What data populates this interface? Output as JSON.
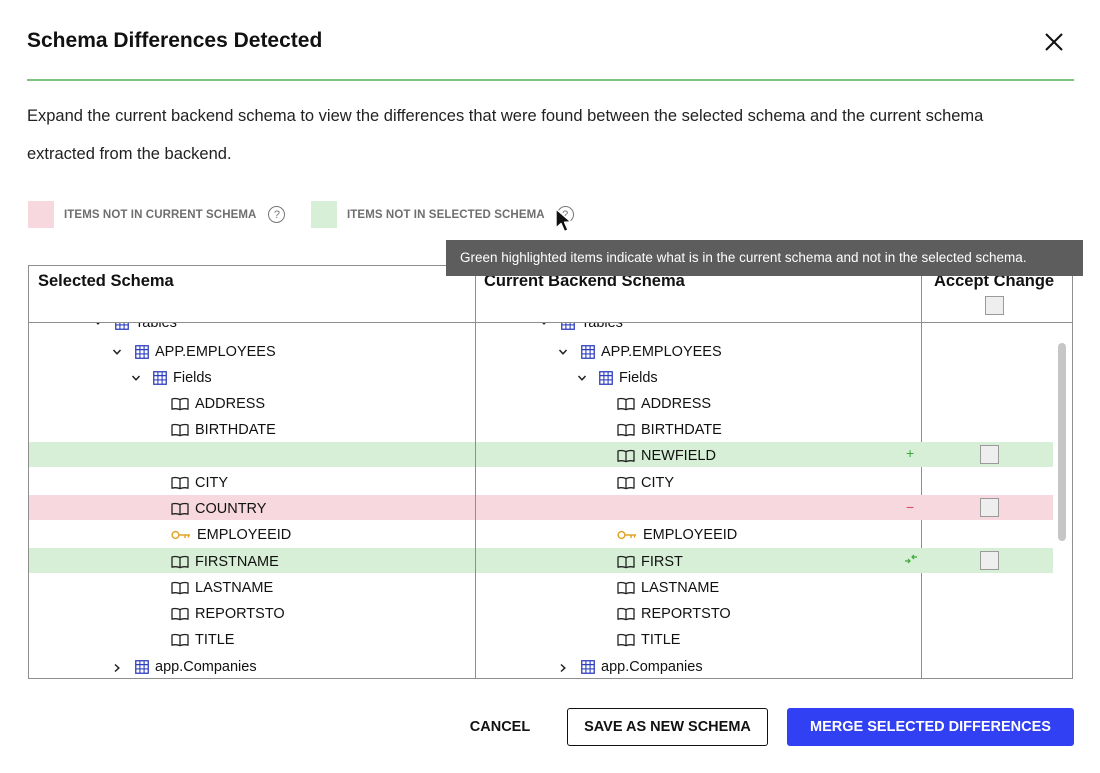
{
  "dialog": {
    "title": "Schema Differences Detected",
    "description": "Expand the current backend schema to view the differences that were found between the selected schema and the current schema extracted from the backend."
  },
  "legend": {
    "not_in_current": {
      "label": "ITEMS NOT IN CURRENT SCHEMA",
      "color": "#f6d8de",
      "help_icon": "?"
    },
    "not_in_selected": {
      "label": "ITEMS NOT IN SELECTED SCHEMA",
      "color": "#d6efd6",
      "help_icon": "?"
    }
  },
  "tooltip": "Green highlighted items indicate what is in the current schema and not in the selected schema.",
  "table": {
    "headers": {
      "selected": "Selected Schema",
      "current": "Current Backend Schema",
      "accept": "Accept Change"
    },
    "selected_tree": {
      "tables_label": "Tables",
      "employees_label": "APP.EMPLOYEES",
      "fields_label": "Fields",
      "field_address": "ADDRESS",
      "field_birthdate": "BIRTHDATE",
      "field_city": "CITY",
      "field_country": "COUNTRY",
      "field_employeeid": "EMPLOYEEID",
      "field_firstname": "FIRSTNAME",
      "field_lastname": "LASTNAME",
      "field_reportsto": "REPORTSTO",
      "field_title": "TITLE",
      "companies_label": "app.Companies"
    },
    "current_tree": {
      "tables_label": "Tables",
      "employees_label": "APP.EMPLOYEES",
      "fields_label": "Fields",
      "field_address": "ADDRESS",
      "field_birthdate": "BIRTHDATE",
      "field_newfield": "NEWFIELD",
      "field_city": "CITY",
      "field_employeeid": "EMPLOYEEID",
      "field_first": "FIRST",
      "field_lastname": "LASTNAME",
      "field_reportsto": "REPORTSTO",
      "field_title": "TITLE",
      "companies_label": "app.Companies"
    },
    "change_marks": {
      "added": "+",
      "removed": "−"
    },
    "colors": {
      "added_row": "#d6efd6",
      "removed_row": "#f6d8de",
      "table_icon": "#2f3fbf",
      "key_icon": "#e0a020",
      "added_mark": "#3aa83a",
      "removed_mark": "#d9465f"
    }
  },
  "buttons": {
    "cancel": "CANCEL",
    "save_new": "SAVE AS NEW SCHEMA",
    "merge": "MERGE SELECTED DIFFERENCES"
  }
}
